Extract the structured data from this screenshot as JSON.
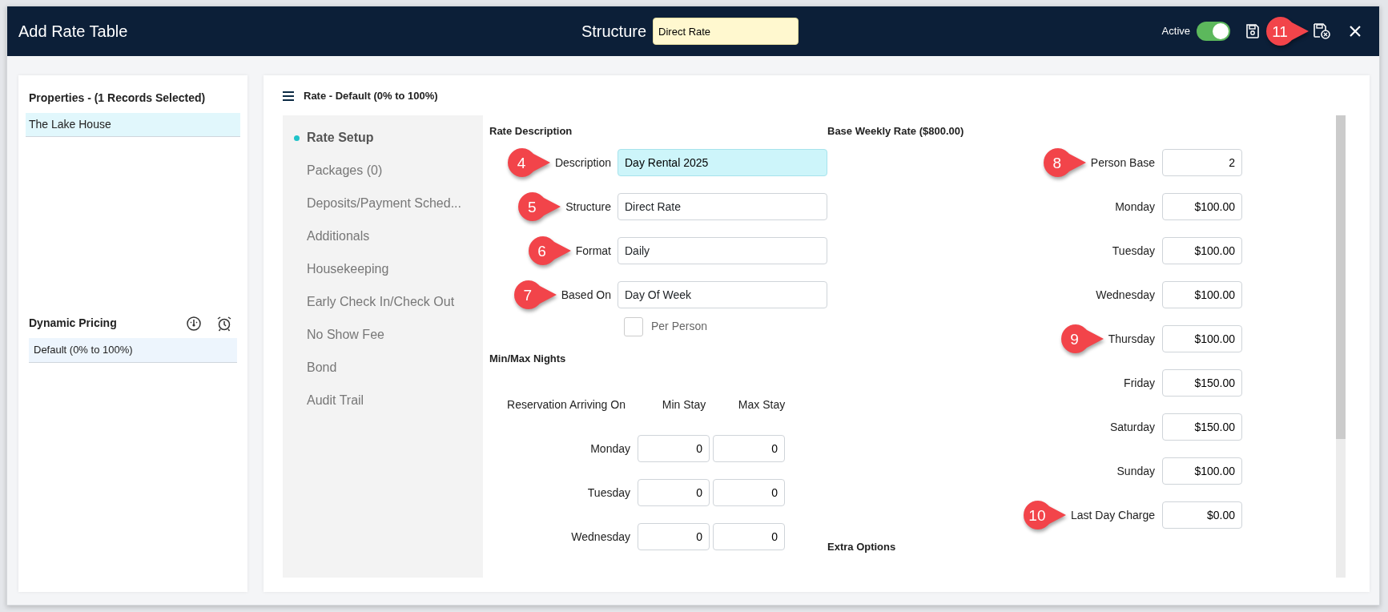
{
  "window": {
    "title": "Add Rate Table"
  },
  "header": {
    "structure_label": "Structure",
    "structure_value": "Direct Rate",
    "active_label": "Active",
    "active_on": true,
    "callout": "11"
  },
  "properties": {
    "title": "Properties - (1 Records Selected)",
    "items": [
      {
        "label": "The Lake House",
        "selected": true
      }
    ]
  },
  "dynamic_pricing": {
    "title": "Dynamic Pricing",
    "items": [
      {
        "label": "Default (0% to 100%)",
        "selected": true
      }
    ]
  },
  "rate_panel": {
    "title": "Rate - Default (0% to 100%)"
  },
  "nav": [
    {
      "label": "Rate Setup",
      "selected": true
    },
    {
      "label": "Packages (0)",
      "selected": false
    },
    {
      "label": "Deposits/Payment Sched...",
      "selected": false
    },
    {
      "label": "Additionals",
      "selected": false
    },
    {
      "label": "Housekeeping",
      "selected": false
    },
    {
      "label": "Early Check In/Check Out",
      "selected": false
    },
    {
      "label": "No Show Fee",
      "selected": false
    },
    {
      "label": "Bond",
      "selected": false
    },
    {
      "label": "Audit Trail",
      "selected": false
    }
  ],
  "rate_description": {
    "title": "Rate Description",
    "fields": [
      {
        "kind": "text",
        "label": "Description",
        "value": "Day Rental 2025",
        "callout": "4",
        "focused": true
      },
      {
        "kind": "select",
        "label": "Structure",
        "value": "Direct Rate",
        "callout": "5",
        "focused": false
      },
      {
        "kind": "select",
        "label": "Format",
        "value": "Daily",
        "callout": "6",
        "focused": false
      },
      {
        "kind": "select",
        "label": "Based On",
        "value": "Day Of Week",
        "callout": "7",
        "focused": false
      }
    ],
    "per_person": {
      "label": "Per Person",
      "checked": false
    }
  },
  "min_max": {
    "title": "Min/Max Nights",
    "columns": [
      "Reservation Arriving On",
      "Min Stay",
      "Max Stay"
    ],
    "rows": [
      {
        "day": "Monday",
        "min": "0",
        "max": "0"
      },
      {
        "day": "Tuesday",
        "min": "0",
        "max": "0"
      },
      {
        "day": "Wednesday",
        "min": "0",
        "max": "0"
      }
    ]
  },
  "base_weekly": {
    "title": "Base Weekly Rate ($800.00)",
    "rows": [
      {
        "label": "Person Base",
        "value": "2",
        "callout": "8"
      },
      {
        "label": "Monday",
        "value": "$100.00"
      },
      {
        "label": "Tuesday",
        "value": "$100.00"
      },
      {
        "label": "Wednesday",
        "value": "$100.00"
      },
      {
        "label": "Thursday",
        "value": "$100.00",
        "callout": "9"
      },
      {
        "label": "Friday",
        "value": "$150.00"
      },
      {
        "label": "Saturday",
        "value": "$150.00"
      },
      {
        "label": "Sunday",
        "value": "$100.00"
      },
      {
        "label": "Last Day Charge",
        "value": "$0.00",
        "callout": "10"
      }
    ]
  },
  "extra_options": {
    "title": "Extra Options"
  }
}
